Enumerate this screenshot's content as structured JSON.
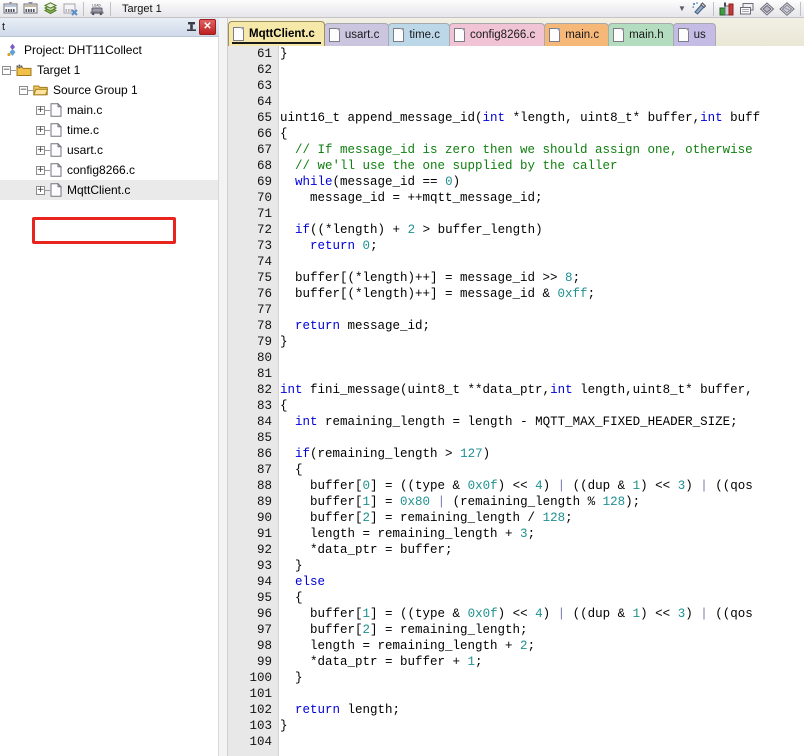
{
  "toolbar": {
    "buttons": [
      {
        "name": "build-icon",
        "label": "Build"
      },
      {
        "name": "rebuild-icon",
        "label": "Rebuild"
      },
      {
        "name": "batch-build-icon",
        "label": "Batch Build"
      },
      {
        "name": "stop-build-icon",
        "label": "Stop Build"
      },
      {
        "name": "download-icon",
        "label": "Download"
      }
    ],
    "target_value": "Target 1",
    "right_buttons": [
      {
        "name": "target-options-icon",
        "label": "Options for Target"
      },
      {
        "name": "manage-project-items-icon",
        "label": "Manage Project Items"
      },
      {
        "name": "pack-installer-icon",
        "label": "Pack Installer"
      },
      {
        "name": "manage-run-time-icon",
        "label": "Manage Run-Time Environment"
      },
      {
        "name": "multi-project-icon",
        "label": "Multi-Project"
      }
    ],
    "dropdown_arrow": "▼"
  },
  "project_pane": {
    "title": "t",
    "pin_icon": "➡",
    "close_label": "✕",
    "tree": [
      {
        "label": "Project: DHT11Collect",
        "depth": 0,
        "icon": "project-icon",
        "expander": null
      },
      {
        "label": "Target 1",
        "depth": 1,
        "icon": "target-icon",
        "expander": "-"
      },
      {
        "label": "Source Group 1",
        "depth": 2,
        "icon": "folder-icon",
        "expander": "-"
      },
      {
        "label": "main.c",
        "depth": 3,
        "icon": "c-file-icon",
        "expander": "+"
      },
      {
        "label": "time.c",
        "depth": 3,
        "icon": "c-file-icon",
        "expander": "+"
      },
      {
        "label": "usart.c",
        "depth": 3,
        "icon": "c-file-icon",
        "expander": "+"
      },
      {
        "label": "config8266.c",
        "depth": 3,
        "icon": "c-file-icon",
        "expander": "+"
      },
      {
        "label": "MqttClient.c",
        "depth": 3,
        "icon": "c-file-icon",
        "expander": "+",
        "selected": true,
        "highlighted": true
      }
    ],
    "highlight_color": "#e8241f"
  },
  "editor": {
    "tabs": [
      {
        "label": "MqttClient.c",
        "color": "#f5e8a8",
        "active": true
      },
      {
        "label": "usart.c",
        "color": "#ccc5e0",
        "active": false
      },
      {
        "label": "time.c",
        "color": "#bcd8e8",
        "active": false
      },
      {
        "label": "config8266.c",
        "color": "#f0c4d4",
        "active": false
      },
      {
        "label": "main.c",
        "color": "#f6b878",
        "active": false
      },
      {
        "label": "main.h",
        "color": "#b4ddc0",
        "active": false
      },
      {
        "label": "us",
        "color": "#c4bce4",
        "active": false
      }
    ],
    "first_line": 61,
    "lines": [
      {
        "n": 61,
        "tokens": [
          {
            "t": "}",
            "c": ""
          }
        ]
      },
      {
        "n": 62,
        "tokens": []
      },
      {
        "n": 63,
        "tokens": []
      },
      {
        "n": 64,
        "tokens": []
      },
      {
        "n": 65,
        "tokens": [
          {
            "t": "uint16_t append_message_id(",
            "c": ""
          },
          {
            "t": "int",
            "c": "kw"
          },
          {
            "t": " *length, uint8_t* buffer,",
            "c": ""
          },
          {
            "t": "int",
            "c": "kw"
          },
          {
            "t": " buff",
            "c": ""
          }
        ]
      },
      {
        "n": 66,
        "tokens": [
          {
            "t": "{",
            "c": ""
          }
        ]
      },
      {
        "n": 67,
        "tokens": [
          {
            "t": "  // If message_id is zero then we should assign one, otherwise",
            "c": "cm"
          }
        ]
      },
      {
        "n": 68,
        "tokens": [
          {
            "t": "  // we'll use the one supplied by the caller",
            "c": "cm"
          }
        ]
      },
      {
        "n": 69,
        "tokens": [
          {
            "t": "  ",
            "c": ""
          },
          {
            "t": "while",
            "c": "kw"
          },
          {
            "t": "(message_id == ",
            "c": ""
          },
          {
            "t": "0",
            "c": "num"
          },
          {
            "t": ")",
            "c": ""
          }
        ]
      },
      {
        "n": 70,
        "tokens": [
          {
            "t": "    message_id = ++mqtt_message_id;",
            "c": ""
          }
        ]
      },
      {
        "n": 71,
        "tokens": []
      },
      {
        "n": 72,
        "tokens": [
          {
            "t": "  ",
            "c": ""
          },
          {
            "t": "if",
            "c": "kw"
          },
          {
            "t": "((*length) + ",
            "c": ""
          },
          {
            "t": "2",
            "c": "num"
          },
          {
            "t": " > buffer_length)",
            "c": ""
          }
        ]
      },
      {
        "n": 73,
        "tokens": [
          {
            "t": "    ",
            "c": ""
          },
          {
            "t": "return",
            "c": "kw"
          },
          {
            "t": " ",
            "c": ""
          },
          {
            "t": "0",
            "c": "num"
          },
          {
            "t": ";",
            "c": ""
          }
        ]
      },
      {
        "n": 74,
        "tokens": []
      },
      {
        "n": 75,
        "tokens": [
          {
            "t": "  buffer[(*length)++] = message_id >> ",
            "c": ""
          },
          {
            "t": "8",
            "c": "num"
          },
          {
            "t": ";",
            "c": ""
          }
        ]
      },
      {
        "n": 76,
        "tokens": [
          {
            "t": "  buffer[(*length)++] = message_id & ",
            "c": ""
          },
          {
            "t": "0xff",
            "c": "num"
          },
          {
            "t": ";",
            "c": ""
          }
        ]
      },
      {
        "n": 77,
        "tokens": []
      },
      {
        "n": 78,
        "tokens": [
          {
            "t": "  ",
            "c": ""
          },
          {
            "t": "return",
            "c": "kw"
          },
          {
            "t": " message_id;",
            "c": ""
          }
        ]
      },
      {
        "n": 79,
        "tokens": [
          {
            "t": "}",
            "c": ""
          }
        ]
      },
      {
        "n": 80,
        "tokens": []
      },
      {
        "n": 81,
        "tokens": []
      },
      {
        "n": 82,
        "tokens": [
          {
            "t": "",
            "c": ""
          },
          {
            "t": "int",
            "c": "kw"
          },
          {
            "t": " fini_message(uint8_t **data_ptr,",
            "c": ""
          },
          {
            "t": "int",
            "c": "kw"
          },
          {
            "t": " length,uint8_t* buffer,",
            "c": ""
          }
        ]
      },
      {
        "n": 83,
        "tokens": [
          {
            "t": "{",
            "c": ""
          }
        ]
      },
      {
        "n": 84,
        "tokens": [
          {
            "t": "  ",
            "c": ""
          },
          {
            "t": "int",
            "c": "kw"
          },
          {
            "t": " remaining_length = length - MQTT_MAX_FIXED_HEADER_SIZE;",
            "c": ""
          }
        ]
      },
      {
        "n": 85,
        "tokens": []
      },
      {
        "n": 86,
        "tokens": [
          {
            "t": "  ",
            "c": ""
          },
          {
            "t": "if",
            "c": "kw"
          },
          {
            "t": "(remaining_length > ",
            "c": ""
          },
          {
            "t": "127",
            "c": "num"
          },
          {
            "t": ")",
            "c": ""
          }
        ]
      },
      {
        "n": 87,
        "tokens": [
          {
            "t": "  {",
            "c": ""
          }
        ]
      },
      {
        "n": 88,
        "tokens": [
          {
            "t": "    buffer[",
            "c": ""
          },
          {
            "t": "0",
            "c": "num"
          },
          {
            "t": "] = ((type & ",
            "c": ""
          },
          {
            "t": "0x0f",
            "c": "num"
          },
          {
            "t": ") << ",
            "c": ""
          },
          {
            "t": "4",
            "c": "num"
          },
          {
            "t": ") ",
            "c": ""
          },
          {
            "t": "|",
            "c": "op"
          },
          {
            "t": " ((dup & ",
            "c": ""
          },
          {
            "t": "1",
            "c": "num"
          },
          {
            "t": ") << ",
            "c": ""
          },
          {
            "t": "3",
            "c": "num"
          },
          {
            "t": ") ",
            "c": ""
          },
          {
            "t": "|",
            "c": "op"
          },
          {
            "t": " ((qos",
            "c": ""
          }
        ]
      },
      {
        "n": 89,
        "tokens": [
          {
            "t": "    buffer[",
            "c": ""
          },
          {
            "t": "1",
            "c": "num"
          },
          {
            "t": "] = ",
            "c": ""
          },
          {
            "t": "0x80",
            "c": "num"
          },
          {
            "t": " ",
            "c": ""
          },
          {
            "t": "|",
            "c": "op"
          },
          {
            "t": " (remaining_length % ",
            "c": ""
          },
          {
            "t": "128",
            "c": "num"
          },
          {
            "t": ");",
            "c": ""
          }
        ]
      },
      {
        "n": 90,
        "tokens": [
          {
            "t": "    buffer[",
            "c": ""
          },
          {
            "t": "2",
            "c": "num"
          },
          {
            "t": "] = remaining_length / ",
            "c": ""
          },
          {
            "t": "128",
            "c": "num"
          },
          {
            "t": ";",
            "c": ""
          }
        ]
      },
      {
        "n": 91,
        "tokens": [
          {
            "t": "    length = remaining_length + ",
            "c": ""
          },
          {
            "t": "3",
            "c": "num"
          },
          {
            "t": ";",
            "c": ""
          }
        ]
      },
      {
        "n": 92,
        "tokens": [
          {
            "t": "    *data_ptr = buffer;",
            "c": ""
          }
        ]
      },
      {
        "n": 93,
        "tokens": [
          {
            "t": "  }",
            "c": ""
          }
        ]
      },
      {
        "n": 94,
        "tokens": [
          {
            "t": "  ",
            "c": ""
          },
          {
            "t": "else",
            "c": "kw"
          }
        ]
      },
      {
        "n": 95,
        "tokens": [
          {
            "t": "  {",
            "c": ""
          }
        ]
      },
      {
        "n": 96,
        "tokens": [
          {
            "t": "    buffer[",
            "c": ""
          },
          {
            "t": "1",
            "c": "num"
          },
          {
            "t": "] = ((type & ",
            "c": ""
          },
          {
            "t": "0x0f",
            "c": "num"
          },
          {
            "t": ") << ",
            "c": ""
          },
          {
            "t": "4",
            "c": "num"
          },
          {
            "t": ") ",
            "c": ""
          },
          {
            "t": "|",
            "c": "op"
          },
          {
            "t": " ((dup & ",
            "c": ""
          },
          {
            "t": "1",
            "c": "num"
          },
          {
            "t": ") << ",
            "c": ""
          },
          {
            "t": "3",
            "c": "num"
          },
          {
            "t": ") ",
            "c": ""
          },
          {
            "t": "|",
            "c": "op"
          },
          {
            "t": " ((qos",
            "c": ""
          }
        ]
      },
      {
        "n": 97,
        "tokens": [
          {
            "t": "    buffer[",
            "c": ""
          },
          {
            "t": "2",
            "c": "num"
          },
          {
            "t": "] = remaining_length;",
            "c": ""
          }
        ]
      },
      {
        "n": 98,
        "tokens": [
          {
            "t": "    length = remaining_length + ",
            "c": ""
          },
          {
            "t": "2",
            "c": "num"
          },
          {
            "t": ";",
            "c": ""
          }
        ]
      },
      {
        "n": 99,
        "tokens": [
          {
            "t": "    *data_ptr = buffer + ",
            "c": ""
          },
          {
            "t": "1",
            "c": "num"
          },
          {
            "t": ";",
            "c": ""
          }
        ]
      },
      {
        "n": 100,
        "tokens": [
          {
            "t": "  }",
            "c": ""
          }
        ]
      },
      {
        "n": 101,
        "tokens": []
      },
      {
        "n": 102,
        "tokens": [
          {
            "t": "  ",
            "c": ""
          },
          {
            "t": "return",
            "c": "kw"
          },
          {
            "t": " length;",
            "c": ""
          }
        ]
      },
      {
        "n": 103,
        "tokens": [
          {
            "t": "}",
            "c": ""
          }
        ]
      },
      {
        "n": 104,
        "tokens": []
      }
    ]
  }
}
